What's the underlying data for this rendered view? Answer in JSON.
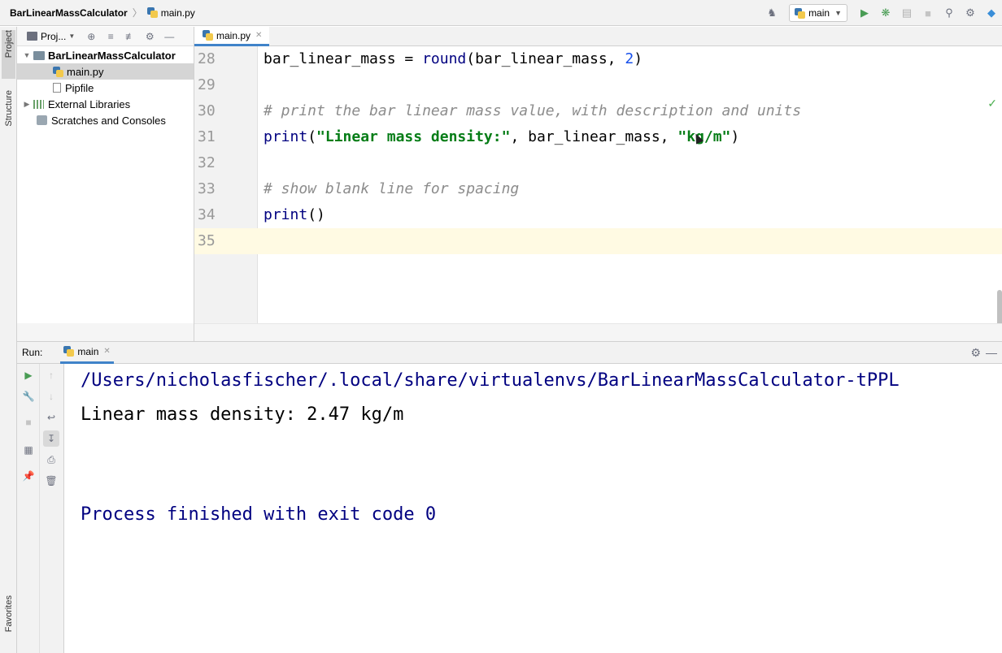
{
  "navbar": {
    "project_name": "BarLinearMassCalculator",
    "separator": "〉",
    "file_name": "main.py",
    "run_config": "main"
  },
  "left_stripe": {
    "project_tab": "Project",
    "structure_tab": "Structure",
    "favorites_tab": "Favorites"
  },
  "project_panel": {
    "header_label": "Proj...",
    "tree": [
      {
        "label": "BarLinearMassCalculator",
        "bold": true
      },
      {
        "label": "main.py"
      },
      {
        "label": "Pipfile"
      },
      {
        "label": "External Libraries"
      },
      {
        "label": "Scratches and Consoles"
      }
    ]
  },
  "editor": {
    "tab_label": "main.py",
    "line_numbers": [
      "28",
      "29",
      "30",
      "31",
      "32",
      "33",
      "34",
      "35"
    ],
    "code": {
      "l28_a": "bar_linear_mass = ",
      "l28_b": "round",
      "l28_c": "(bar_linear_mass, ",
      "l28_d": "2",
      "l28_e": ")",
      "l30": "# print the bar linear mass value, with description and units",
      "l31_a": "print",
      "l31_b": "(",
      "l31_c": "\"Linear mass density:\"",
      "l31_d": ", bar_linear_mass, ",
      "l31_e": "\"kg/m\"",
      "l31_f": ")",
      "l33": "# show blank line for spacing",
      "l34_a": "print",
      "l34_b": "()"
    }
  },
  "run_panel": {
    "run_label": "Run:",
    "tab_label": "main",
    "output": [
      "/Users/nicholasfischer/.local/share/virtualenvs/BarLinearMassCalculator-tPPL",
      "Linear mass density: 2.47 kg/m",
      "",
      "",
      "Process finished with exit code 0"
    ]
  }
}
